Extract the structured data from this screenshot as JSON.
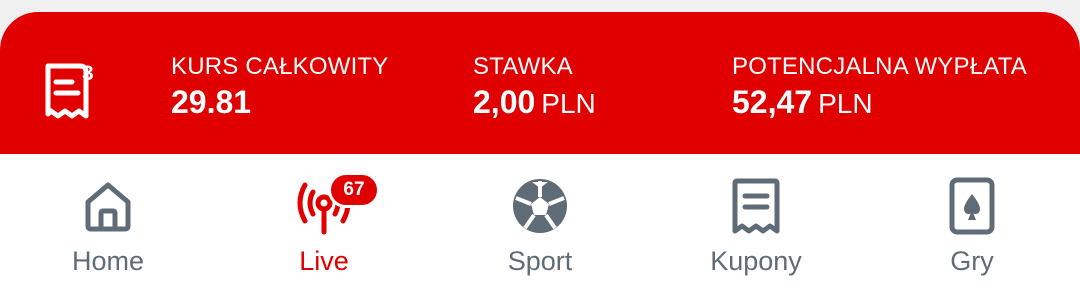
{
  "betslip": {
    "count": "3",
    "odds_label": "KURS CAŁKOWITY",
    "odds_value": "29.81",
    "stake_label": "STAWKA",
    "stake_value": "2,00",
    "stake_currency": "PLN",
    "payout_label": "POTENCJALNA WYPŁATA",
    "payout_value": "52,47",
    "payout_currency": "PLN"
  },
  "nav": {
    "items": [
      {
        "label": "Home",
        "icon": "home-icon"
      },
      {
        "label": "Live",
        "icon": "live-broadcast-icon",
        "badge": "67",
        "active": true
      },
      {
        "label": "Sport",
        "icon": "soccer-ball-icon"
      },
      {
        "label": "Kupony",
        "icon": "receipt-icon"
      },
      {
        "label": "Gry",
        "icon": "playing-card-icon"
      }
    ]
  },
  "colors": {
    "brand_red": "#e10000",
    "inactive_gray": "#5f6b76",
    "background": "#ffffff"
  }
}
